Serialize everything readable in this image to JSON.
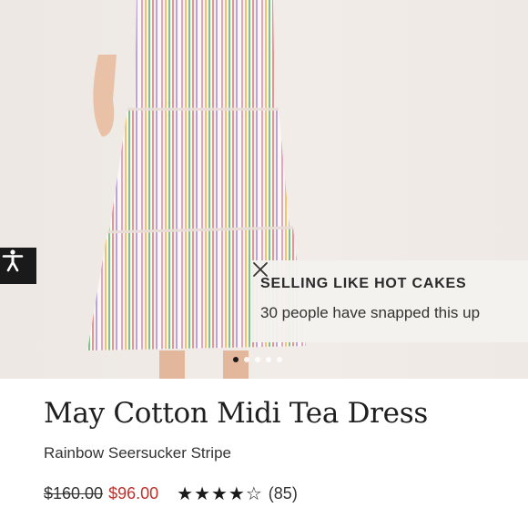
{
  "toast": {
    "title": "SELLING LIKE HOT CAKES",
    "message": "30 people have snapped this up"
  },
  "carousel": {
    "slides": 5,
    "active_index": 0
  },
  "product": {
    "name": "May Cotton Midi Tea Dress",
    "variant": "Rainbow Seersucker Stripe",
    "original_price": "$160.00",
    "sale_price": "$96.00",
    "rating": 4,
    "rating_max": 5,
    "stars_display": "★★★★☆",
    "review_count": "(85)"
  },
  "icons": {
    "accessibility": "accessibility-icon",
    "close": "close-icon"
  },
  "colors": {
    "sale_price": "#c0312b",
    "accessibility_bg": "#1a1a1a"
  }
}
